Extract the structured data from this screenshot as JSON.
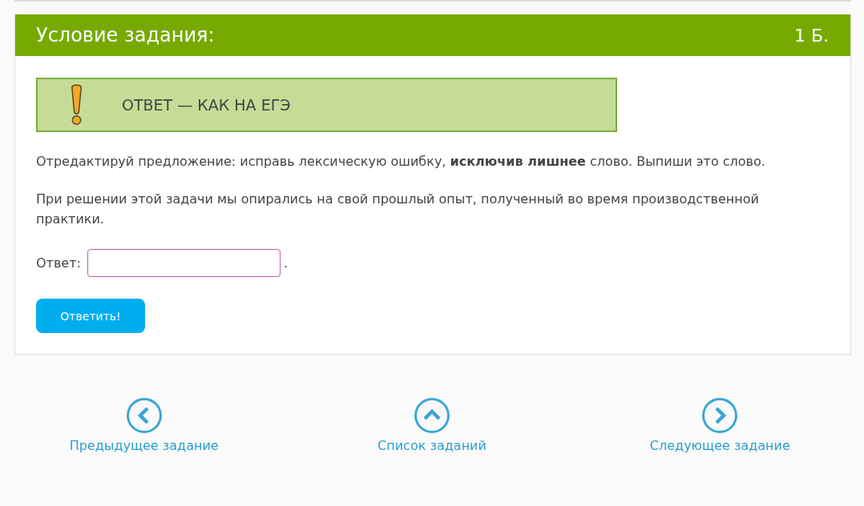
{
  "task": {
    "title": "Условие задания:",
    "points": "1 Б.",
    "notice": {
      "text": "ОТВЕТ — КАК НА ЕГЭ"
    },
    "instruction": "Отредактируй предложение: исправь лексическую ошибку, **исключив лишнее** слово. Выпиши это слово.",
    "sentence": "При решении этой задачи мы опирались на свой прошлый опыт, полученный во время производственной практики.",
    "answer": {
      "label": "Ответ:",
      "suffix": "."
    },
    "submit_button": "Ответить!"
  },
  "navigation": [
    {
      "kind": "previous",
      "label": "Предыдущее задание"
    },
    {
      "kind": "list",
      "label": "Список заданий"
    },
    {
      "kind": "next",
      "label": "Следующее задание"
    }
  ]
}
